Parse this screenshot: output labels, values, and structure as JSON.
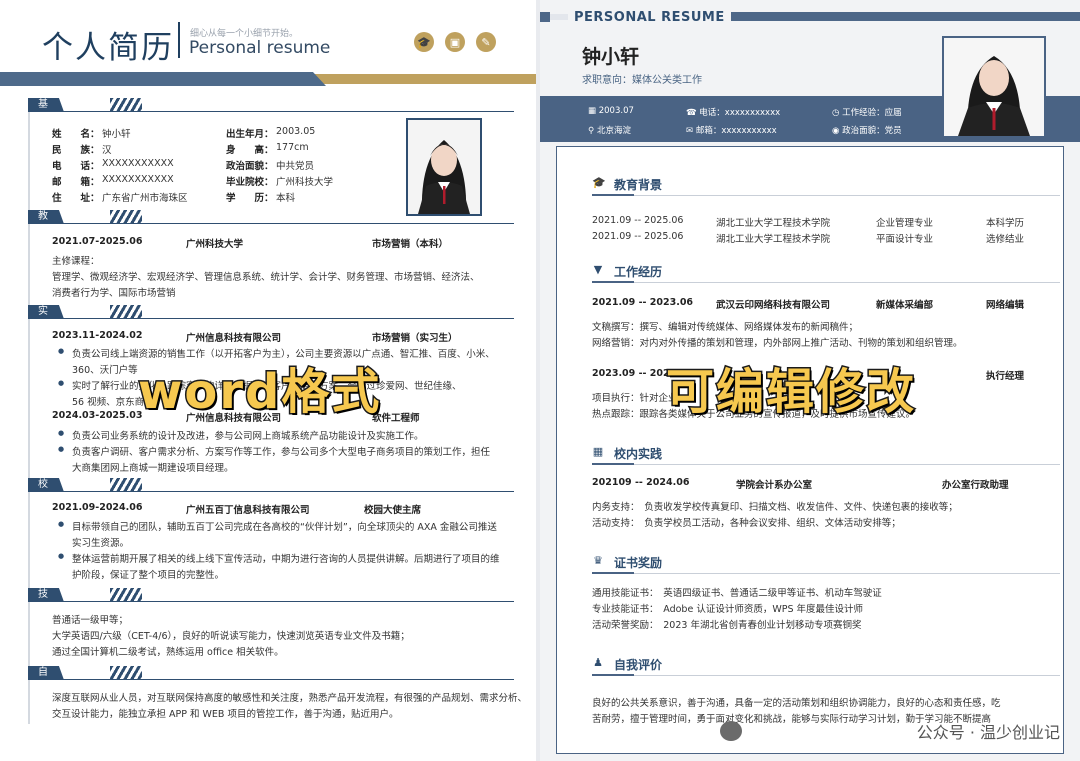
{
  "left": {
    "title": "个人简历",
    "slogan": "细心从每一个小细节开始。",
    "subtitle": "Personal resume",
    "sections": {
      "basic": "基本信息",
      "education": "教育背景",
      "internship": "实习经历",
      "campus": "校园经历",
      "skills": "技能证书",
      "self": "自我评价"
    },
    "basic": [
      {
        "k": "姓　　名：",
        "v": "钟小轩"
      },
      {
        "k": "民　　族：",
        "v": "汉"
      },
      {
        "k": "电　　话：",
        "v": "XXXXXXXXXXX"
      },
      {
        "k": "邮　　箱：",
        "v": "XXXXXXXXXXX"
      },
      {
        "k": "住　　址：",
        "v": "广东省广州市海珠区"
      }
    ],
    "basic2": [
      {
        "k": "出生年月：",
        "v": "2003.05"
      },
      {
        "k": "身　　高：",
        "v": "177cm"
      },
      {
        "k": "政治面貌：",
        "v": "中共党员"
      },
      {
        "k": "毕业院校：",
        "v": "广州科技大学"
      },
      {
        "k": "学　　历：",
        "v": "本科"
      }
    ],
    "edu": {
      "date": "2021.07-2025.06",
      "school": "广州科技大学",
      "major": "市场营销（本科）",
      "courses_label": "主修课程：",
      "courses1": "管理学、微观经济学、宏观经济学、管理信息系统、统计学、会计学、财务管理、市场营销、经济法、",
      "courses2": "消费者行为学、国际市场营销"
    },
    "intern": {
      "date1": "2023.11-2024.02",
      "company1": "广州信息科技有限公司",
      "role1": "市场营销（实习生）",
      "b1a": "负责公司线上端资源的销售工作（以开拓客户为主），公司主要资源以广点通、智汇推、百度、小米、",
      "b1b": "360、沃门户等",
      "b2a": "实时了解行业的变化，跟踪客户的详细数据，为客户制定更方案，合作过珍爱网、世纪佳缘、",
      "b2b": "56 视频、京东商城",
      "date2": "2024.03-2025.03",
      "company2": "广州信息科技有限公司",
      "role2": "软件工程师",
      "b3": "负责公司业务系统的设计及改进，参与公司网上商城系统产品功能设计及实施工作。",
      "b4a": "负责客户调研、客户需求分析、方案写作等工作，参与公司多个大型电子商务项目的策划工作，担任",
      "b4b": "大商集团网上商城一期建设项目经理。"
    },
    "campus": {
      "date": "2021.09-2024.06",
      "company": "广州五百丁信息科技有限公司",
      "role": "校园大使主席",
      "b1a": "目标带领自己的团队，辅助五百丁公司完成在各高校的“伙伴计划”，向全球顶尖的 AXA 金融公司推送",
      "b1b": "实习生资源。",
      "b2a": "整体运营前期开展了相关的线上线下宣传活动，中期为进行咨询的人员提供讲解。后期进行了项目的维",
      "b2b": "护阶段，保证了整个项目的完整性。"
    },
    "skills": [
      "普通话一级甲等；",
      "大学英语四/六级（CET-4/6），良好的听说读写能力，快速浏览英语专业文件及书籍；",
      "通过全国计算机二级考试，熟练运用 office 相关软件。"
    ],
    "self": [
      "深度互联网从业人员，对互联网保持高度的敏感性和关注度，熟悉产品开发流程，有很强的产品规划、需求分析、",
      "交互设计能力，能独立承担 APP 和 WEB 项目的管控工作，善于沟通，贴近用户。"
    ]
  },
  "right": {
    "title": "PERSONAL RESUME",
    "name": "钟小轩",
    "intent": "求职意向：媒体公关类工作",
    "info": [
      "2003.07",
      "电话：xxxxxxxxxxx",
      "工作经验：应届",
      "北京海淀",
      "邮箱：xxxxxxxxxxx",
      "政治面貌：党员"
    ],
    "sections": {
      "education": "教育背景",
      "work": "工作经历",
      "campus": "校内实践",
      "awards": "证书奖励",
      "self": "自我评价"
    },
    "edu": [
      {
        "date": "2021.09 -- 2025.06",
        "school": "湖北工业大学工程技术学院",
        "major": "企业管理专业",
        "degree": "本科学历"
      },
      {
        "date": "2021.09 -- 2025.06",
        "school": "湖北工业大学工程技术学院",
        "major": "平面设计专业",
        "degree": "选修结业"
      }
    ],
    "work": {
      "date1": "2021.09 -- 2023.06",
      "company1": "武汉云印网络科技有限公司",
      "dept1": "新媒体采编部",
      "role1": "网络编辑",
      "l1": "文稿撰写：撰写、编辑对传统媒体、网络媒体发布的新闻稿件；",
      "l2": "网络营销：对内对外传播的策划和管理，内外部网上推广活动、刊物的策划和组织管理。",
      "date2": "2023.09 -- 2024",
      "role2": "执行经理",
      "l3": "项目执行：针对企业",
      "l4": "热点跟踪：跟踪各类媒体关于公司业务的宣传报道，及时提供市场宣传建议。"
    },
    "campus": {
      "date": "202109 -- 2024.06",
      "org": "学院会计系办公室",
      "role": "办公室行政助理",
      "l1": "内务支持：　负责收发学校传真复印、扫描文档、收发信件、文件、快递包裹的接收等；",
      "l2": "活动支持：　负责学校员工活动，各种会议安排、组织、文体活动安排等；"
    },
    "awards": [
      "通用技能证书：　英语四级证书、普通话二级甲等证书、机动车驾驶证",
      "专业技能证书：　Adobe 认证设计师资质，WPS 年度最佳设计师",
      "活动荣誉奖励：　2023 年湖北省创青春创业计划移动专项赛铜奖"
    ],
    "self": [
      "良好的公共关系意识，善于沟通，具备一定的活动策划和组织协调能力，良好的心态和责任感，吃",
      "苦耐劳，擅于管理时间，勇于面对变化和挑战，能够与实际行动学习计划，勤于学习能不断提高"
    ]
  },
  "overlay": {
    "left": "word格式",
    "right": "可编辑修改",
    "watermark": "公众号 · 温少创业记"
  },
  "colors": {
    "navy": "#2f4e70",
    "gold": "#bfa15e",
    "bar": "#4a6384",
    "overlay": "#f6c84f"
  }
}
